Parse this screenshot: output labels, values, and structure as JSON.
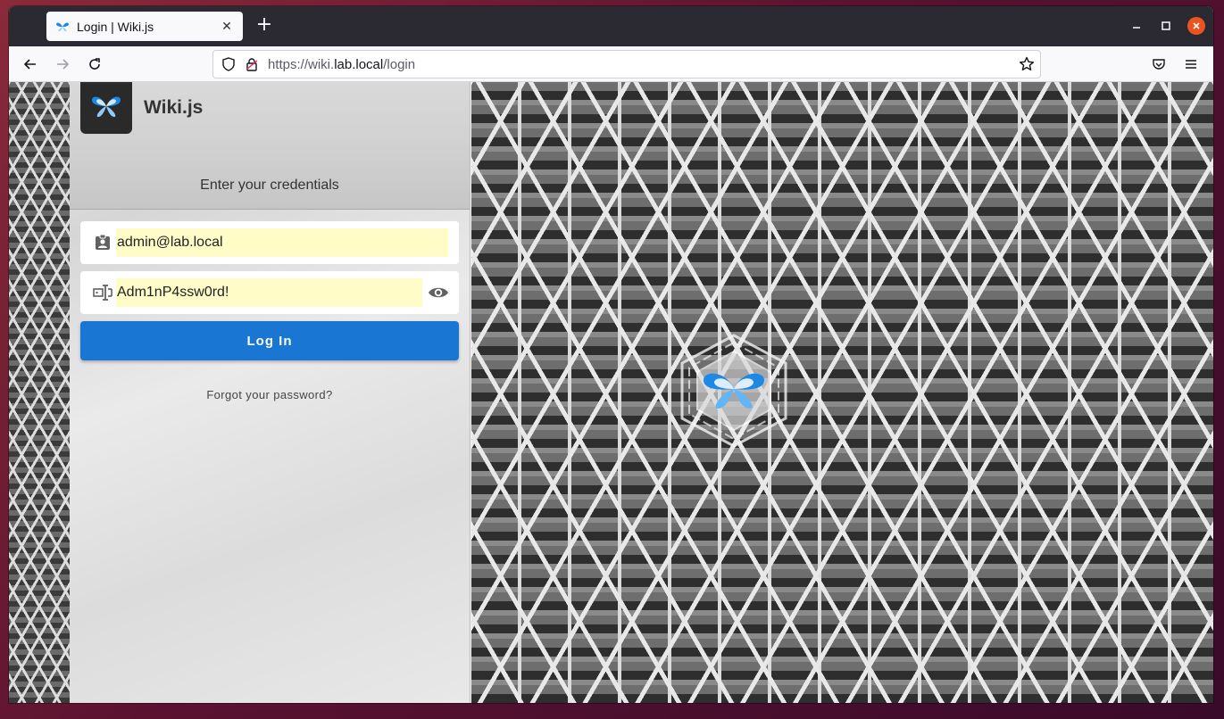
{
  "browser": {
    "tab_title": "Login | Wiki.js",
    "new_tab_label": "+",
    "url_prefix": "https://wiki.",
    "url_domain": "lab.local",
    "url_path": "/login"
  },
  "page": {
    "brand": "Wiki.js",
    "subtitle": "Enter your credentials",
    "email_value": "admin@lab.local",
    "password_value": "Adm1nP4ssw0rd!",
    "login_label": "Log In",
    "forgot_label": "Forgot your password?"
  },
  "colors": {
    "accent": "#1976d2",
    "autofill": "#fffcc8",
    "close_button": "#e95420"
  }
}
